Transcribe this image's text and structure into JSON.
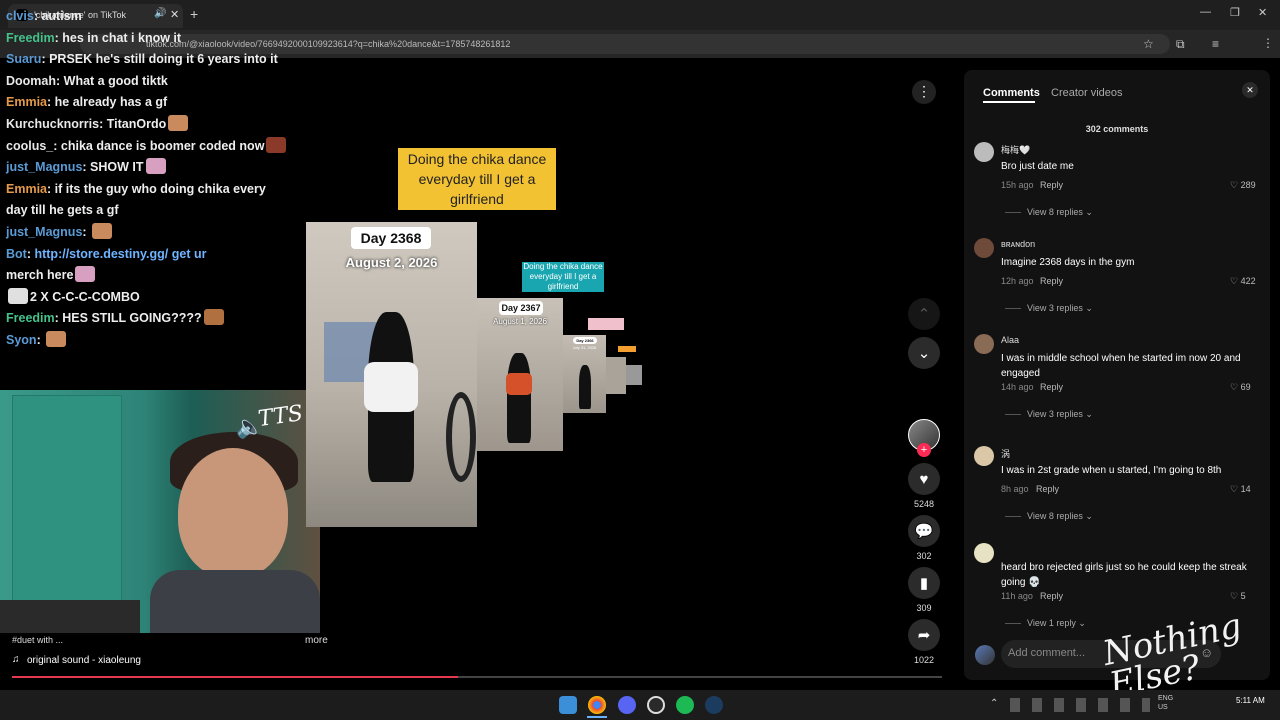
{
  "browser": {
    "tab_title": "'chika dance' on TikTok",
    "url": "tiktok.com/@xiaolook/video/7669492000109923614?q=chika%20dance&t=1785748261812",
    "new_tab_label": "+"
  },
  "chat": {
    "lines": [
      {
        "user": "clvis",
        "user_color": "#5b9bd5",
        "text": "autism"
      },
      {
        "user": "Freedim",
        "user_color": "#45c18a",
        "text": "hes in chat i know it"
      },
      {
        "user": "Suaru",
        "user_color": "#5b9bd5",
        "text": "PRSEK he's still doing it 6 years into it"
      },
      {
        "user": "Doomah",
        "user_color": "#e8e8e8",
        "text": "What a good tiktk"
      },
      {
        "user": "Emmia",
        "user_color": "#e39a4a",
        "text": "he already has a gf"
      },
      {
        "user": "Kurchucknorris",
        "user_color": "#e8e8e8",
        "text": "TitanOrdo"
      },
      {
        "user": "coolus_",
        "user_color": "#e8e8e8",
        "text": "chika dance is boomer coded now"
      },
      {
        "user": "just_Magnus",
        "user_color": "#5b9bd5",
        "text": "SHOW IT"
      },
      {
        "user": "Emmia",
        "user_color": "#e39a4a",
        "text": "if its the guy who doing chika every"
      },
      {
        "user": "",
        "user_color": "#e8e8e8",
        "text": "day till he gets a gf"
      },
      {
        "user": "just_Magnus",
        "user_color": "#5b9bd5",
        "text": ""
      },
      {
        "user": "Bot",
        "user_color": "#5b9bd5",
        "text": "http://store.destiny.gg/ get ur"
      },
      {
        "user": "",
        "user_color": "#e8e8e8",
        "text": "merch here"
      },
      {
        "user": "",
        "user_color": "#e8e8e8",
        "text": "2 X C-C-C-COMBO"
      },
      {
        "user": "Freedim",
        "user_color": "#45c18a",
        "text": "HES STILL GOING????"
      },
      {
        "user": "Syon",
        "user_color": "#5b9bd5",
        "text": ""
      }
    ]
  },
  "overlay": {
    "tts_label": "TTS ON",
    "watermark": "Nothing Else?"
  },
  "video": {
    "caption": "Doing the chika dance everyday till I get a girlfriend",
    "frames": [
      {
        "day": "Day 2368",
        "date": "August 2, 2026"
      },
      {
        "day": "Day 2367",
        "date": "August 1, 2026"
      },
      {
        "day": "Day 2366",
        "date": "July 31, 2026"
      }
    ],
    "description": "#duet with ...",
    "more_label": "more",
    "sound": "original sound - xiaoleung",
    "progress": 0.48
  },
  "actions": {
    "likes": "5248",
    "comments": "302",
    "saves": "309",
    "shares": "1022"
  },
  "comments_panel": {
    "tabs": [
      "Comments",
      "Creator videos"
    ],
    "count_label": "302 comments",
    "add_placeholder": "Add comment...",
    "items": [
      {
        "name": "梅梅🤍",
        "text": "Bro just date me",
        "time": "15h ago",
        "likes": "289",
        "replies": "View 8 replies",
        "avatar": "#bcbcbc"
      },
      {
        "name": "ʙʀᴀɴdon",
        "text": "Imagine 2368 days in the gym",
        "time": "12h ago",
        "likes": "422",
        "replies": "View 3 replies",
        "avatar": "#6e4a3a"
      },
      {
        "name": "Alaa",
        "text": "I was in middle school when he started im now 20 and engaged",
        "time": "14h ago",
        "likes": "69",
        "replies": "View 3 replies",
        "avatar": "#8a6b55"
      },
      {
        "name": "涡",
        "text": "I was in 2st grade when u started, I'm going to 8th",
        "time": "8h ago",
        "likes": "14",
        "replies": "View 8 replies",
        "avatar": "#d9c7a8"
      },
      {
        "name": "",
        "text": "heard bro rejected girls just so he could keep the streak going 💀",
        "time": "11h ago",
        "likes": "5",
        "replies": "View 1 reply",
        "avatar": "#e8e2c4"
      }
    ],
    "reply_label": "Reply"
  },
  "taskbar": {
    "time": "5:11 AM",
    "lang": "ENG US",
    "icons": [
      "windows-icon",
      "chrome-icon",
      "discord-icon",
      "obs-icon",
      "spotify-icon",
      "steam-icon"
    ]
  }
}
